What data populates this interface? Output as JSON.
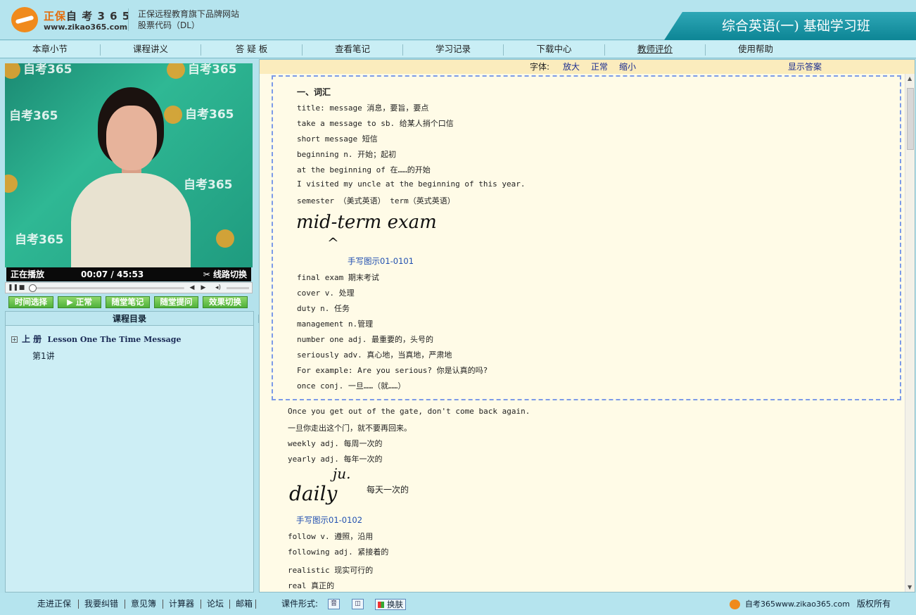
{
  "header": {
    "brand_cn": "正保",
    "brand_rest": "自 考 3 6 5",
    "brand_url": "www.zikao365.com",
    "tagline1": "正保远程教育旗下品牌网站",
    "tagline2": "股票代码（DL）",
    "course_title": "综合英语(一) 基础学习班"
  },
  "nav": [
    "本章小节",
    "课程讲义",
    "答 疑 板",
    "查看笔记",
    "学习记录",
    "下载中心",
    "教师评价",
    "使用帮助"
  ],
  "video": {
    "watermark": "自考365",
    "watermark_url": "www.zikao365.com",
    "status": "正在播放",
    "time_current": "00:07",
    "time_sep": "/",
    "time_total": "45:53",
    "switch_label": "线路切换",
    "progress": 0.003
  },
  "actions": [
    "时间选择",
    "正常",
    "随堂笔记",
    "随堂提问",
    "效果切换"
  ],
  "catalog": {
    "title": "课程目录",
    "book_cn": "上  册",
    "book_en": "Lesson One The Time Message",
    "lecture": "第1讲"
  },
  "toolbar": {
    "font_label": "字体:",
    "enlarge": "放大",
    "normal": "正常",
    "shrink": "缩小",
    "show_answer": "显示答案"
  },
  "notes": {
    "heading": "一、词汇",
    "box_lines": [
      "title: message 消息，要旨，要点",
      "take a message to sb. 给某人捎个口信",
      "short message 短信",
      "beginning n. 开始；起初",
      "at the beginning of 在……的开始",
      "I visited my uncle at the beginning of this year.",
      "semester （美式英语） term（英式英语）"
    ],
    "handwriting1": "mid-term exam",
    "caption1": "手写图示01-0101",
    "box_lines2": [
      "final exam 期末考试",
      "cover v. 处理",
      "duty n. 任务",
      "management n.管理",
      "number one adj. 最重要的，头号的",
      "seriously adv. 真心地，当真地，严肃地",
      "For example: Are you serious? 你是认真的吗?",
      "once conj. 一旦……（就……）"
    ],
    "after_lines": [
      "Once you get out of the gate, don't come back again.",
      "一旦你走出这个门，就不要再回来。",
      "weekly adj. 每周一次的",
      "yearly adj. 每年一次的"
    ],
    "handwriting2": "daily",
    "handwriting2_note": "ju.",
    "handwriting2_meaning": "每天一次的",
    "caption2": "手写图示01-0102",
    "after_lines2": [
      "follow v. 遵照，沿用",
      "following adj. 紧接着的",
      "realistic 现实可行的",
      "real 真正的"
    ]
  },
  "footer": {
    "links": [
      "走进正保",
      "我要纠错",
      "意见簿",
      "计算器",
      "论坛",
      "邮箱"
    ],
    "format_label": "课件形式:",
    "format_icon1": "音",
    "skin_label": "换肤",
    "site": "自考365www.zikao365.com",
    "copyright": "版权所有"
  },
  "colors": {
    "header_bg": "#b5e4ee",
    "title_bar": "#0d8595",
    "notes_bg": "#fffbe7",
    "action_green": "#4fb13a",
    "link_blue": "#1b2c8f"
  }
}
